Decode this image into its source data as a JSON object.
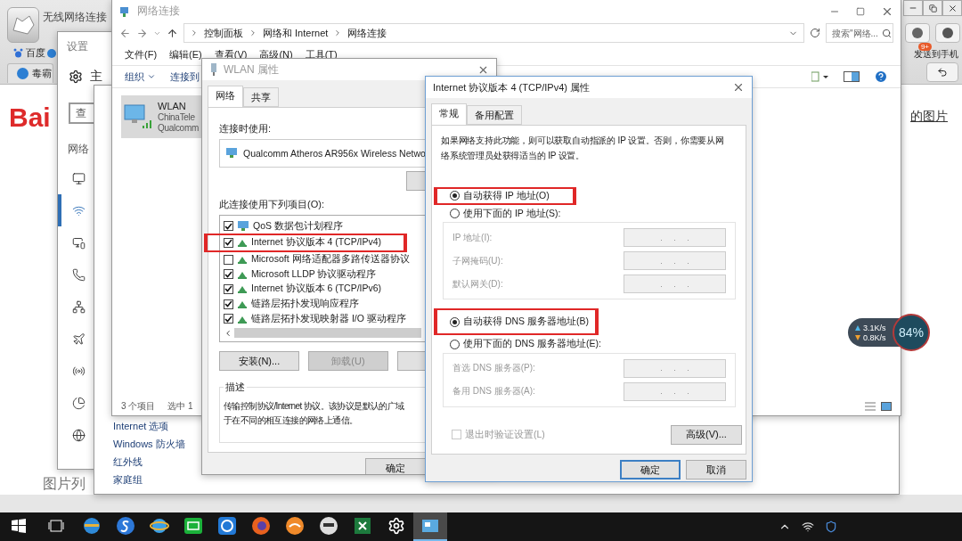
{
  "browser": {
    "title": "无线网络连接",
    "bookmark": "百度",
    "tab": "毒霸",
    "logo": "Bai",
    "link": "的图片",
    "badge": "9+",
    "send_to_phone": "发送到手机",
    "footer_heading": "图片列"
  },
  "settings": {
    "title": "设置",
    "home": "主",
    "search": {
      "placeholder": "查"
    },
    "section": "网络",
    "nav": [
      {
        "kind": "status",
        "selected": false
      },
      {
        "kind": "wifi",
        "selected": true
      },
      {
        "kind": "ethernet",
        "selected": false
      },
      {
        "kind": "dialup",
        "selected": false
      },
      {
        "kind": "vpn",
        "selected": false
      },
      {
        "kind": "airplane",
        "selected": false
      },
      {
        "kind": "hotspot",
        "selected": false
      },
      {
        "kind": "data",
        "selected": false
      },
      {
        "kind": "proxy",
        "selected": false
      }
    ]
  },
  "control_panel": {
    "links": [
      "Internet 选项",
      "Windows 防火墙",
      "红外线",
      "家庭组"
    ]
  },
  "explorer": {
    "title": "网络连接",
    "breadcrumb": [
      "控制面板",
      "网络和 Internet",
      "网络连接"
    ],
    "search": {
      "placeholder": "搜索\"网络..."
    },
    "menu": [
      "文件(F)",
      "编辑(E)",
      "查看(V)",
      "高级(N)",
      "工具(T)"
    ],
    "toolbar": [
      "组织",
      "连接到"
    ],
    "connection": {
      "name": "WLAN",
      "network": "ChinaTele",
      "adapter": "Qualcomm",
      "selected": true
    },
    "status": [
      "3 个项目",
      "选中 1"
    ]
  },
  "wlan_dialog": {
    "title": "WLAN 属性",
    "tabs": [
      {
        "label": "网络",
        "selected": true
      },
      {
        "label": "共享",
        "selected": false
      }
    ],
    "connect_using": "连接时使用:",
    "adapter": "Qualcomm Atheros AR956x Wireless Netwo",
    "items_label": "此连接使用下列项目(O):",
    "items": [
      {
        "label": "QoS 数据包计划程序",
        "checked": true,
        "kind": "service",
        "highlighted": false
      },
      {
        "label": "Internet 协议版本 4 (TCP/IPv4)",
        "checked": true,
        "kind": "protocol",
        "highlighted": true
      },
      {
        "label": "Microsoft 网络适配器多路传送器协议",
        "checked": false,
        "kind": "protocol",
        "highlighted": false
      },
      {
        "label": "Microsoft LLDP 协议驱动程序",
        "checked": true,
        "kind": "protocol",
        "highlighted": false
      },
      {
        "label": "Internet 协议版本 6 (TCP/IPv6)",
        "checked": true,
        "kind": "protocol",
        "highlighted": false
      },
      {
        "label": "链路层拓扑发现响应程序",
        "checked": true,
        "kind": "protocol",
        "highlighted": false
      },
      {
        "label": "链路层拓扑发现映射器 I/O 驱动程序",
        "checked": true,
        "kind": "protocol",
        "highlighted": false
      }
    ],
    "buttons": [
      {
        "label": "安装(N)...",
        "disabled": false
      },
      {
        "label": "卸载(U)",
        "disabled": true
      }
    ],
    "description_title": "描述",
    "description": [
      "传输控制协议/Internet 协议。该协议是默认的广域",
      "于在不同的相互连接的网络上通信。"
    ],
    "ok": "确定"
  },
  "ipv4_dialog": {
    "title": "Internet 协议版本 4 (TCP/IPv4) 属性",
    "tabs": [
      {
        "label": "常规",
        "selected": true
      },
      {
        "label": "备用配置",
        "selected": false
      }
    ],
    "intro": [
      "如果网络支持此功能，则可以获取自动指派的 IP 设置。否则，你需要从网",
      "络系统管理员处获得适当的 IP 设置。"
    ],
    "ip_options": [
      {
        "label": "自动获得 IP 地址(O)",
        "selected": true,
        "highlighted": true
      },
      {
        "label": "使用下面的 IP 地址(S):",
        "selected": false,
        "highlighted": false
      }
    ],
    "ip_fields": [
      {
        "label": "IP 地址(I):",
        "value": ".     .     ."
      },
      {
        "label": "子网掩码(U):",
        "value": ".     .     ."
      },
      {
        "label": "默认网关(D):",
        "value": ".     .     ."
      }
    ],
    "dns_options": [
      {
        "label": "自动获得 DNS 服务器地址(B)",
        "selected": true,
        "highlighted": true
      },
      {
        "label": "使用下面的 DNS 服务器地址(E):",
        "selected": false,
        "highlighted": false
      }
    ],
    "dns_fields": [
      {
        "label": "首选 DNS 服务器(P):",
        "value": ".     .     ."
      },
      {
        "label": "备用 DNS 服务器(A):",
        "value": ".     .     ."
      }
    ],
    "validate": {
      "label": "退出时验证设置(L)",
      "checked": false,
      "disabled": true
    },
    "advanced": "高级(V)...",
    "ok": "确定",
    "cancel": "取消"
  },
  "speed_widget": {
    "upload": "3.1K/s",
    "download": "0.8K/s",
    "percent": "84%"
  },
  "taskbar": {
    "apps": [
      {
        "kind": "edge",
        "selected": false
      },
      {
        "kind": "sogou",
        "selected": false
      },
      {
        "kind": "ie",
        "selected": false
      },
      {
        "kind": "iqiyi",
        "selected": false
      },
      {
        "kind": "kugou",
        "selected": false
      },
      {
        "kind": "firefox",
        "selected": false
      },
      {
        "kind": "orange",
        "selected": false
      },
      {
        "kind": "ghost",
        "selected": false
      },
      {
        "kind": "excel",
        "selected": false
      },
      {
        "kind": "settings",
        "selected": false
      },
      {
        "kind": "network",
        "selected": true
      }
    ]
  }
}
